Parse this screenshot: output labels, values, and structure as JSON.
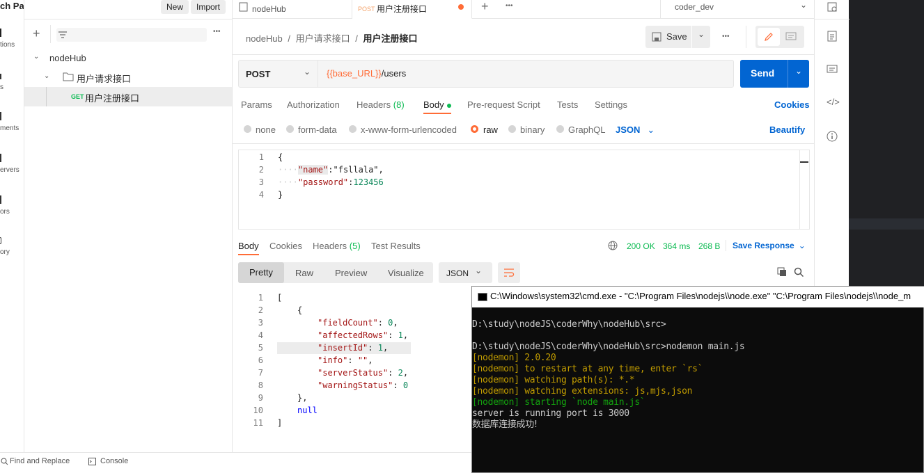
{
  "rail": {
    "items": [
      "tions",
      "s",
      "ments",
      "ervers",
      "ors",
      "ory"
    ]
  },
  "sidebar": {
    "title": "ch Pad",
    "new_label": "New",
    "import_label": "Import",
    "more": "•••",
    "tree": {
      "workspace": "nodeHub",
      "folder": "用户请求接口",
      "request_method": "GET",
      "request_name": "用户注册接口"
    }
  },
  "tabs": {
    "tab1": "nodeHub",
    "tab2_method": "POST",
    "tab2_label": "用户注册接口",
    "more": "•••",
    "environment": "coder_dev"
  },
  "breadcrumb": {
    "part1": "nodeHub",
    "sep": "/",
    "part2": "用户请求接口",
    "part3": "用户注册接口"
  },
  "toolbar": {
    "save_label": "Save",
    "more": "•••"
  },
  "request": {
    "method": "POST",
    "url_var": "{{base_URL}}",
    "url_path": "/users",
    "send_label": "Send"
  },
  "req_tabs": {
    "params": "Params",
    "authorization": "Authorization",
    "headers": "Headers",
    "headers_count": "(8)",
    "body": "Body",
    "prerequest": "Pre-request Script",
    "tests": "Tests",
    "settings": "Settings",
    "cookies": "Cookies"
  },
  "body_types": {
    "none": "none",
    "form_data": "form-data",
    "urlencoded": "x-www-form-urlencoded",
    "raw": "raw",
    "binary": "binary",
    "graphql": "GraphQL",
    "format": "JSON",
    "beautify": "Beautify"
  },
  "req_body": {
    "lines": [
      "1",
      "2",
      "3",
      "4"
    ],
    "l1": "{",
    "l2_indent": "····",
    "l2_key": "\"name\"",
    "l2_rest": ":\"fsllala\",",
    "l3_indent": "····",
    "l3_key": "\"password\"",
    "l3_rest": ":",
    "l3_val": "123456",
    "l4": "}"
  },
  "resp_tabs": {
    "body": "Body",
    "cookies": "Cookies",
    "headers": "Headers",
    "headers_count": "(5)",
    "test_results": "Test Results",
    "status": "200 OK",
    "time": "364 ms",
    "size": "268 B",
    "save_response": "Save Response"
  },
  "resp_view": {
    "pretty": "Pretty",
    "raw": "Raw",
    "preview": "Preview",
    "visualize": "Visualize",
    "format": "JSON"
  },
  "resp_body": {
    "lines": [
      "1",
      "2",
      "3",
      "4",
      "5",
      "6",
      "7",
      "8",
      "9",
      "10",
      "11"
    ],
    "l1": "[",
    "l2": "{",
    "k3": "\"fieldCount\"",
    "v3": "0",
    "k4": "\"affectedRows\"",
    "v4": "1",
    "k5": "\"insertId\"",
    "v5": "1",
    "k6": "\"info\"",
    "v6": "\"\"",
    "k7": "\"serverStatus\"",
    "v7": "2",
    "k8": "\"warningStatus\"",
    "v8": "0",
    "l9": "},",
    "l10": "null",
    "l11": "]"
  },
  "footer": {
    "find_replace": "Find and Replace",
    "console": "Console"
  },
  "cmd": {
    "title": "C:\\Windows\\system32\\cmd.exe  - \"C:\\Program Files\\nodejs\\\\node.exe\"   \"C:\\Program Files\\nodejs\\\\node_m",
    "line1": "D:\\study\\nodeJS\\coderWhy\\nodeHub\\src>",
    "line2": "D:\\study\\nodeJS\\coderWhy\\nodeHub\\src>nodemon main.js",
    "line3": "[nodemon] 2.0.20",
    "line4": "[nodemon] to restart at any time, enter `rs`",
    "line5": "[nodemon] watching path(s): *.*",
    "line6": "[nodemon] watching extensions: js,mjs,json",
    "line7": "[nodemon] starting `node main.js`",
    "line8": "server is running port is 3000",
    "line9": "数据库连接成功!"
  },
  "colors": {
    "accent": "#ff6c37",
    "send_blue": "#0265d2",
    "link_blue": "#0265d2",
    "key_purple": "#a31515",
    "yellow": "#c19c00",
    "green": "#13a10e"
  }
}
